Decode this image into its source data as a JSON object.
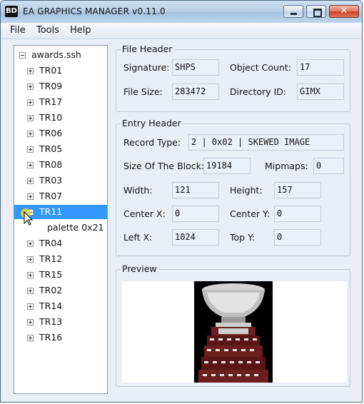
{
  "window": {
    "app_icon": "BD",
    "title": "EA GRAPHICS MANAGER v0.11.0",
    "controls": {
      "minimize": "minimize-icon",
      "maximize": "maximize-icon",
      "close": "✕"
    }
  },
  "menu": {
    "file": "File",
    "tools": "Tools",
    "help": "Help"
  },
  "tree": {
    "root": "awards.ssh",
    "items_before": [
      "TR01",
      "TR09",
      "TR17",
      "TR10",
      "TR06",
      "TR05",
      "TR08",
      "TR03",
      "TR07"
    ],
    "selected": "TR11",
    "child": "palette 0x21",
    "items_after": [
      "TR04",
      "TR12",
      "TR15",
      "TR02",
      "TR14",
      "TR13",
      "TR16"
    ]
  },
  "file_header": {
    "title": "File Header",
    "signature_label": "Signature:",
    "signature": "SHPS",
    "object_count_label": "Object Count:",
    "object_count": "17",
    "file_size_label": "File Size:",
    "file_size": "283472",
    "directory_id_label": "Directory ID:",
    "directory_id": "GIMX"
  },
  "entry_header": {
    "title": "Entry Header",
    "record_type_label": "Record Type:",
    "record_type": "2 | 0x02 | SKEWED IMAGE",
    "block_size_label": "Size Of The Block:",
    "block_size": "19184",
    "mipmaps_label": "Mipmaps:",
    "mipmaps": "0",
    "width_label": "Width:",
    "width": "121",
    "height_label": "Height:",
    "height": "157",
    "center_x_label": "Center X:",
    "center_x": "0",
    "center_y_label": "Center Y:",
    "center_y": "0",
    "left_x_label": "Left X:",
    "left_x": "1024",
    "top_y_label": "Top Y:",
    "top_y": "0"
  },
  "preview": {
    "title": "Preview",
    "image": "trophy-image"
  },
  "colors": {
    "selection": "#3399ff",
    "window_bg": "#e9eef5",
    "close_button": "#c9432a"
  }
}
